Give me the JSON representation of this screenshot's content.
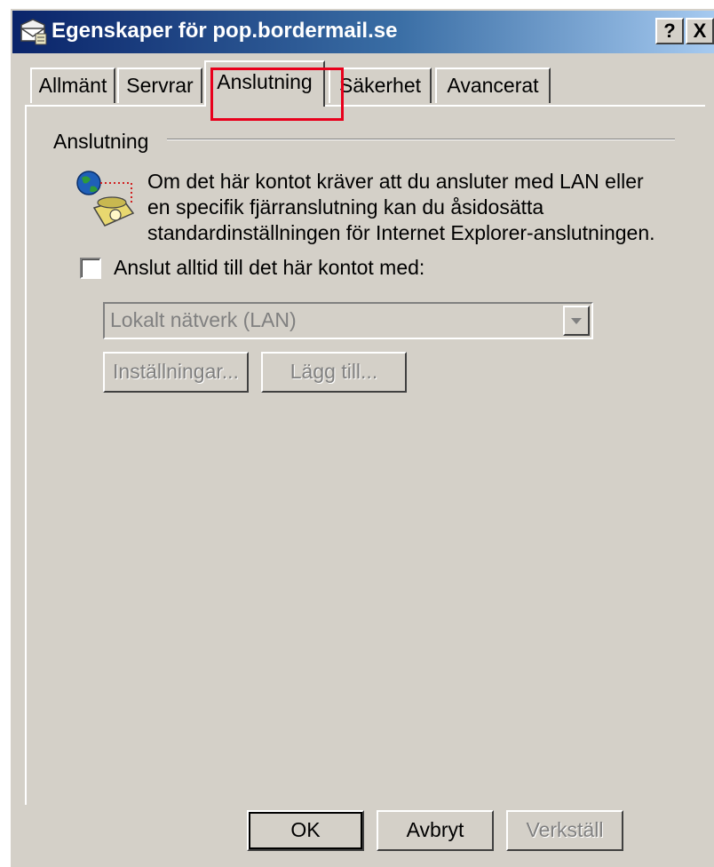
{
  "window": {
    "title": "Egenskaper för pop.bordermail.se",
    "help_label": "?",
    "close_label": "X"
  },
  "tabs": [
    {
      "label": "Allmänt",
      "active": false
    },
    {
      "label": "Servrar",
      "active": false
    },
    {
      "label": "Anslutning",
      "active": true
    },
    {
      "label": "Säkerhet",
      "active": false
    },
    {
      "label": "Avancerat",
      "active": false
    }
  ],
  "connection": {
    "group_label": "Anslutning",
    "description_lines": [
      "Om det här kontot kräver att du ansluter med LAN eller",
      "en specifik fjärranslutning kan du åsidosätta",
      "standardinställningen för Internet Explorer-anslutningen."
    ],
    "always_connect_label": "Anslut alltid till det här kontot med:",
    "always_connect_checked": false,
    "connection_select_value": "Lokalt nätverk (LAN)",
    "settings_button": "Inställningar...",
    "add_button": "Lägg till..."
  },
  "footer": {
    "ok": "OK",
    "cancel": "Avbryt",
    "apply": "Verkställ"
  },
  "colors": {
    "dialog_face": "#d4d0c8",
    "title_gradient_start": "#0a246a",
    "title_gradient_end": "#a6caf0",
    "highlight_box": "#e8001c",
    "disabled_text": "#808080"
  },
  "icons": [
    "mail-properties-icon",
    "connection-globe-phone-icon",
    "dropdown-arrow-icon"
  ]
}
